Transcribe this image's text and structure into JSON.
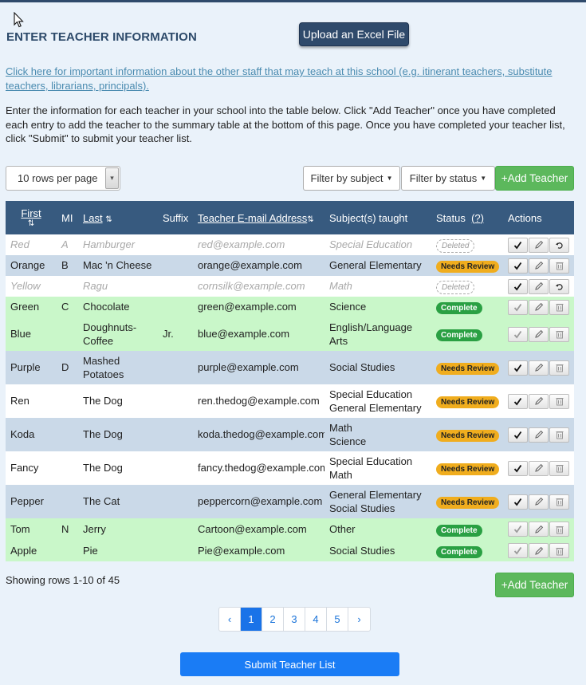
{
  "header": {
    "title": "ENTER TEACHER INFORMATION",
    "upload_label": "Upload an Excel File"
  },
  "info_link": "Click here for important information about the other staff that may teach at this school (e.g. itinerant teachers, substitute teachers, librarians, principals).",
  "intro": "Enter the information for each teacher in your school into the table below. Click \"Add Teacher\" once you have completed each entry to add the teacher to the summary table at the bottom of this page. Once you have completed your teacher list, click \"Submit\" to submit your teacher list.",
  "controls": {
    "rows_per_page": "10 rows per page",
    "filter_subject": "Filter by subject",
    "filter_status": "Filter by status",
    "add_teacher": "+Add Teacher"
  },
  "table": {
    "columns": {
      "first": "First",
      "mi": "MI",
      "last": "Last",
      "suffix": "Suffix",
      "email": "Teacher E-mail Address",
      "subjects": "Subject(s) taught",
      "status": "Status",
      "help": "(?)",
      "actions": "Actions"
    },
    "rows": [
      {
        "first": "Red",
        "mi": "A",
        "last": "Hamburger",
        "suffix": "",
        "email": "red@example.com",
        "subjects": "Special Education",
        "status": "Deleted"
      },
      {
        "first": "Orange",
        "mi": "B",
        "last": "Mac 'n Cheese",
        "suffix": "",
        "email": "orange@example.com",
        "subjects": "General Elementary",
        "status": "Needs Review"
      },
      {
        "first": "Yellow",
        "mi": "",
        "last": "Ragu",
        "suffix": "",
        "email": "cornsilk@example.com",
        "subjects": "Math",
        "status": "Deleted"
      },
      {
        "first": "Green",
        "mi": "C",
        "last": "Chocolate",
        "suffix": "",
        "email": "green@example.com",
        "subjects": "Science",
        "status": "Complete"
      },
      {
        "first": "Blue",
        "mi": "",
        "last": "Doughnuts-Coffee",
        "suffix": "Jr.",
        "email": "blue@example.com",
        "subjects": "English/Language Arts",
        "status": "Complete"
      },
      {
        "first": "Purple",
        "mi": "D",
        "last": "Mashed Potatoes",
        "suffix": "",
        "email": "purple@example.com",
        "subjects": "Social Studies",
        "status": "Needs Review"
      },
      {
        "first": "Ren",
        "mi": "",
        "last": "The Dog",
        "suffix": "",
        "email": "ren.thedog@example.com",
        "subjects": "Special Education General Elementary",
        "status": "Needs Review"
      },
      {
        "first": "Koda",
        "mi": "",
        "last": "The Dog",
        "suffix": "",
        "email": "koda.thedog@example.com",
        "subjects": "Math Science",
        "status": "Needs Review"
      },
      {
        "first": "Fancy",
        "mi": "",
        "last": "The Dog",
        "suffix": "",
        "email": "fancy.thedog@example.com",
        "subjects": "Special Education Math",
        "status": "Needs Review"
      },
      {
        "first": "Pepper",
        "mi": "",
        "last": "The Cat",
        "suffix": "",
        "email": "peppercorn@example.com",
        "subjects": "General Elementary Social Studies",
        "status": "Needs Review"
      },
      {
        "first": "Tom",
        "mi": "N",
        "last": "Jerry",
        "suffix": "",
        "email": "Cartoon@example.com",
        "subjects": "Other",
        "status": "Complete"
      },
      {
        "first": "Apple",
        "mi": "",
        "last": "Pie",
        "suffix": "",
        "email": "Pie@example.com",
        "subjects": "Social Studies",
        "status": "Complete"
      }
    ]
  },
  "footer": {
    "showing": "Showing rows 1-10 of 45",
    "pages": [
      "1",
      "2",
      "3",
      "4",
      "5"
    ],
    "submit": "Submit Teacher List"
  },
  "icons": {
    "sort": "sort-icon",
    "confirm": "check-icon",
    "edit": "pencil-icon",
    "delete": "trash-icon",
    "restore": "undo-icon"
  },
  "colors": {
    "header": "#375a7f",
    "needs_review": "#f0ad1e",
    "complete": "#2aa043",
    "add_button": "#5cb85c",
    "submit": "#1a7cf5"
  }
}
